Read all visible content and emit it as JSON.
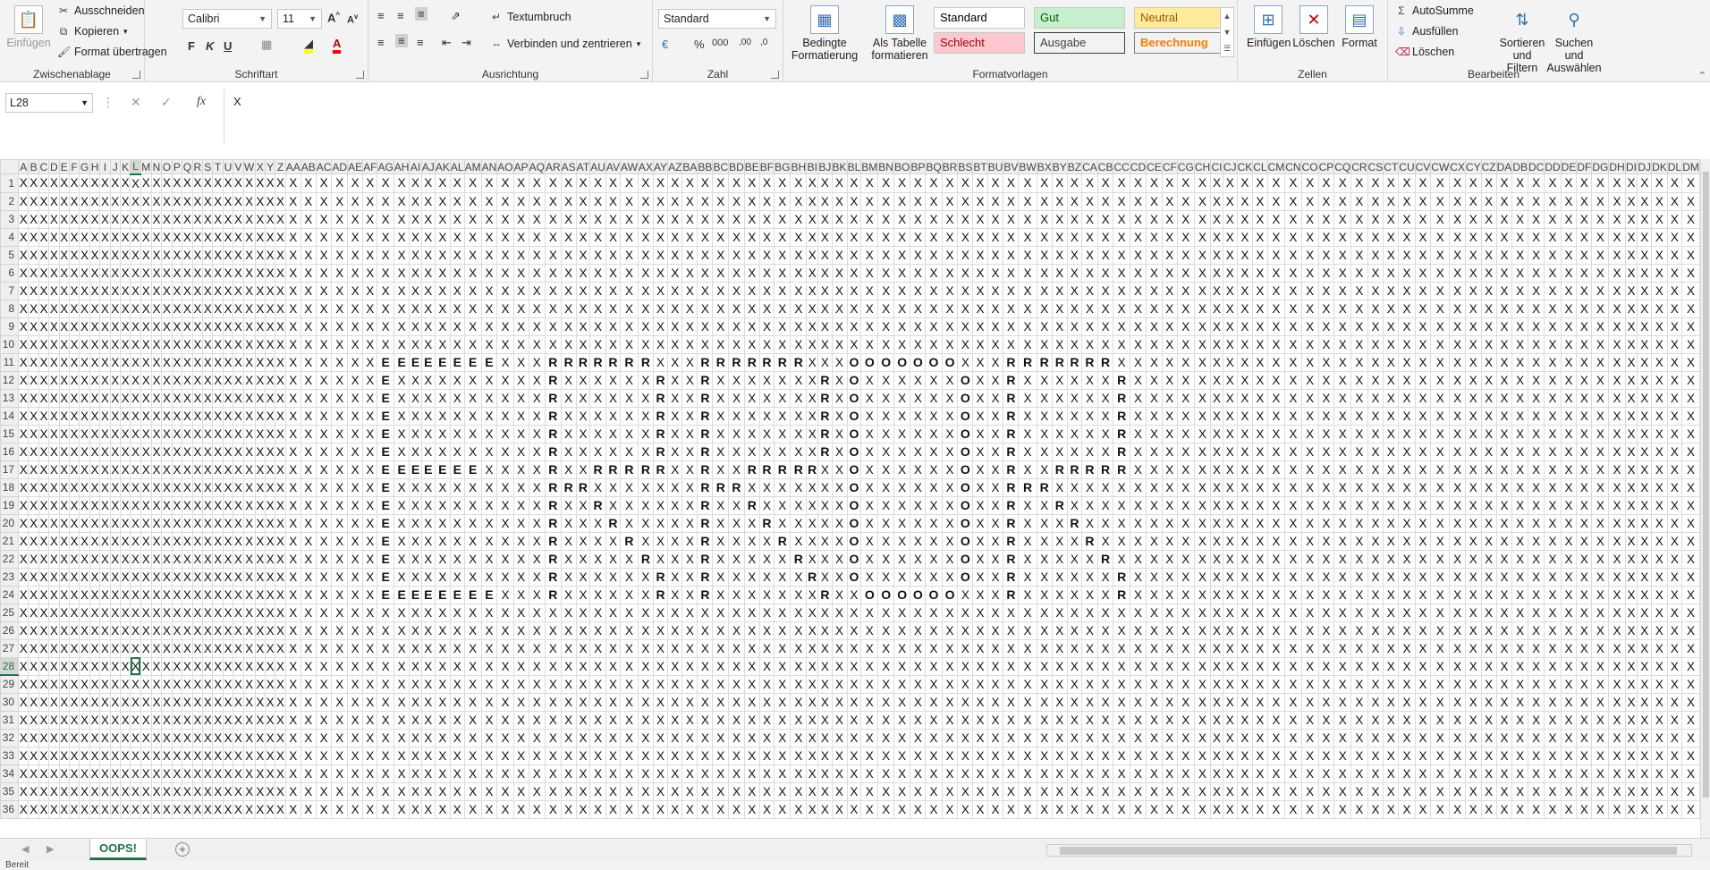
{
  "ribbon": {
    "clipboard": {
      "label": "Zwischenablage",
      "paste": "Einfügen",
      "cut": "Ausschneiden",
      "copy": "Kopieren",
      "format_painter": "Format übertragen"
    },
    "font": {
      "label": "Schriftart",
      "name": "Calibri",
      "size": "11"
    },
    "alignment": {
      "label": "Ausrichtung",
      "wrap": "Textumbruch",
      "merge": "Verbinden und zentrieren"
    },
    "number": {
      "label": "Zahl",
      "format": "Standard"
    },
    "styles": {
      "label": "Formatvorlagen",
      "conditional_1": "Bedingte",
      "conditional_2": "Formatierung",
      "as_table_1": "Als Tabelle",
      "as_table_2": "formatieren",
      "cells": [
        {
          "text": "Standard",
          "bg": "#ffffff",
          "fg": "#000000"
        },
        {
          "text": "Gut",
          "bg": "#c6efce",
          "fg": "#006100"
        },
        {
          "text": "Neutral",
          "bg": "#ffeb9c",
          "fg": "#9c5700"
        },
        {
          "text": "Schlecht",
          "bg": "#ffc7ce",
          "fg": "#9c0006"
        },
        {
          "text": "Ausgabe",
          "bg": "#f2f2f2",
          "fg": "#3f3f3f"
        },
        {
          "text": "Berechnung",
          "bg": "#f2f2f2",
          "fg": "#fa7d00"
        }
      ]
    },
    "cells_group": {
      "label": "Zellen",
      "insert": "Einfügen",
      "delete": "Löschen",
      "format": "Format"
    },
    "editing": {
      "label": "Bearbeiten",
      "autosum": "AutoSumme",
      "fill": "Ausfüllen",
      "clear": "Löschen",
      "sort_1": "Sortieren und",
      "sort_2": "Filtern",
      "find_1": "Suchen und",
      "find_2": "Auswählen"
    }
  },
  "formula_bar": {
    "name_box": "L28",
    "formula": "X",
    "fx": "fx"
  },
  "sheet": {
    "columns": [
      "A",
      "B",
      "C",
      "D",
      "E",
      "F",
      "G",
      "H",
      "I",
      "J",
      "K",
      "L",
      "M",
      "N",
      "O",
      "P",
      "Q",
      "R",
      "S",
      "T",
      "U",
      "V",
      "W",
      "X",
      "Y",
      "Z",
      "AA",
      "AB",
      "AC",
      "AD",
      "AE",
      "AF",
      "AG",
      "AH",
      "AI",
      "AJ",
      "AK",
      "AL",
      "AM",
      "AN",
      "AO",
      "AP",
      "AQ",
      "AR",
      "AS",
      "AT",
      "AU",
      "AV",
      "AW",
      "AX",
      "AY",
      "AZ",
      "BA",
      "BB",
      "BC",
      "BD",
      "BE",
      "BF",
      "BG",
      "BH",
      "BI",
      "BJ",
      "BK",
      "BL",
      "BM",
      "BN",
      "BO",
      "BP",
      "BQ",
      "BR",
      "BS",
      "BT",
      "BU",
      "BV",
      "BW",
      "BX",
      "BY",
      "BZ",
      "CA",
      "CB",
      "CC",
      "CD",
      "CE",
      "CF",
      "CG",
      "CH",
      "CI",
      "CJ",
      "CK",
      "CL",
      "CM",
      "CN",
      "CO",
      "CP",
      "CQ",
      "CR",
      "CS",
      "CT",
      "CU",
      "CV",
      "CW",
      "CX",
      "CY",
      "CZ",
      "DA",
      "DB",
      "DC",
      "DD",
      "DE",
      "DF",
      "DG",
      "DH",
      "DI",
      "DJ",
      "DK",
      "DL",
      "DM"
    ],
    "row_count": 36,
    "default_value": "X",
    "selected": {
      "col": "L",
      "row": 28
    },
    "active_col": "L",
    "active_row": 28,
    "overrides": [
      {
        "row": 11,
        "cells": {
          "AG": "E",
          "AH": "E",
          "AI": "E",
          "AJ": "E",
          "AK": "E",
          "AL": "E",
          "AM": "E",
          "AN": "E",
          "AR": "R",
          "AS": "R",
          "AT": "R",
          "AU": "R",
          "AV": "R",
          "AW": "R",
          "AX": "R",
          "BB": "R",
          "BC": "R",
          "BD": "R",
          "BE": "R",
          "BF": "R",
          "BG": "R",
          "BH": "R",
          "BL": "O",
          "BM": "O",
          "BN": "O",
          "BO": "O",
          "BP": "O",
          "BQ": "O",
          "BR": "O",
          "BV": "R",
          "BW": "R",
          "BX": "R",
          "BY": "R",
          "BZ": "R",
          "CA": "R",
          "CB": "R"
        }
      },
      {
        "row": 12,
        "cells": {
          "AG": "E",
          "AR": "R",
          "AY": "R",
          "BB": "R",
          "BJ": "R",
          "BL": "O",
          "BS": "O",
          "BV": "R",
          "CC": "R"
        }
      },
      {
        "row": 13,
        "cells": {
          "AG": "E",
          "AR": "R",
          "AY": "R",
          "BB": "R",
          "BJ": "R",
          "BL": "O",
          "BS": "O",
          "BV": "R",
          "CC": "R"
        }
      },
      {
        "row": 14,
        "cells": {
          "AG": "E",
          "AR": "R",
          "AY": "R",
          "BB": "R",
          "BJ": "R",
          "BL": "O",
          "BS": "O",
          "BV": "R",
          "CC": "R"
        }
      },
      {
        "row": 15,
        "cells": {
          "AG": "E",
          "AR": "R",
          "AY": "R",
          "BB": "R",
          "BJ": "R",
          "BL": "O",
          "BS": "O",
          "BV": "R",
          "CC": "R"
        }
      },
      {
        "row": 16,
        "cells": {
          "AG": "E",
          "AR": "R",
          "AY": "R",
          "BB": "R",
          "BJ": "R",
          "BL": "O",
          "BS": "O",
          "BV": "R",
          "CC": "R"
        }
      },
      {
        "row": 17,
        "cells": {
          "AG": "E",
          "AH": "E",
          "AI": "E",
          "AJ": "E",
          "AK": "E",
          "AL": "E",
          "AM": "E",
          "AR": "R",
          "AU": "R",
          "AV": "R",
          "AW": "R",
          "AX": "R",
          "AY": "R",
          "BB": "R",
          "BE": "R",
          "BF": "R",
          "BG": "R",
          "BH": "R",
          "BI": "R",
          "BL": "O",
          "BS": "O",
          "BV": "R",
          "BY": "R",
          "BZ": "R",
          "CA": "R",
          "CB": "R",
          "CC": "R"
        }
      },
      {
        "row": 18,
        "cells": {
          "AG": "E",
          "AR": "R",
          "AS": "R",
          "AT": "R",
          "BB": "R",
          "BC": "R",
          "BD": "R",
          "BL": "O",
          "BS": "O",
          "BV": "R",
          "BW": "R",
          "BX": "R"
        }
      },
      {
        "row": 19,
        "cells": {
          "AG": "E",
          "AR": "R",
          "AU": "R",
          "BB": "R",
          "BE": "R",
          "BL": "O",
          "BS": "O",
          "BV": "R",
          "BY": "R"
        }
      },
      {
        "row": 20,
        "cells": {
          "AG": "E",
          "AR": "R",
          "AV": "R",
          "BB": "R",
          "BF": "R",
          "BL": "O",
          "BS": "O",
          "BV": "R",
          "BZ": "R"
        }
      },
      {
        "row": 21,
        "cells": {
          "AG": "E",
          "AR": "R",
          "AW": "R",
          "BB": "R",
          "BG": "R",
          "BL": "O",
          "BS": "O",
          "BV": "R",
          "CA": "R"
        }
      },
      {
        "row": 22,
        "cells": {
          "AG": "E",
          "AR": "R",
          "AX": "R",
          "BB": "R",
          "BH": "R",
          "BL": "O",
          "BS": "O",
          "BV": "R",
          "CB": "R"
        }
      },
      {
        "row": 23,
        "cells": {
          "AG": "E",
          "AR": "R",
          "AY": "R",
          "BB": "R",
          "BI": "R",
          "BL": "O",
          "BS": "O",
          "BV": "R",
          "CC": "R"
        }
      },
      {
        "row": 24,
        "cells": {
          "AG": "E",
          "AH": "E",
          "AI": "E",
          "AJ": "E",
          "AK": "E",
          "AL": "E",
          "AM": "E",
          "AN": "E",
          "AR": "R",
          "AY": "R",
          "BB": "R",
          "BJ": "R",
          "BM": "O",
          "BN": "O",
          "BO": "O",
          "BP": "O",
          "BQ": "O",
          "BR": "O",
          "BV": "R",
          "CC": "R"
        }
      }
    ]
  },
  "tabs": {
    "sheet_name": "OOPS!"
  },
  "status": {
    "text": "Bereit"
  }
}
